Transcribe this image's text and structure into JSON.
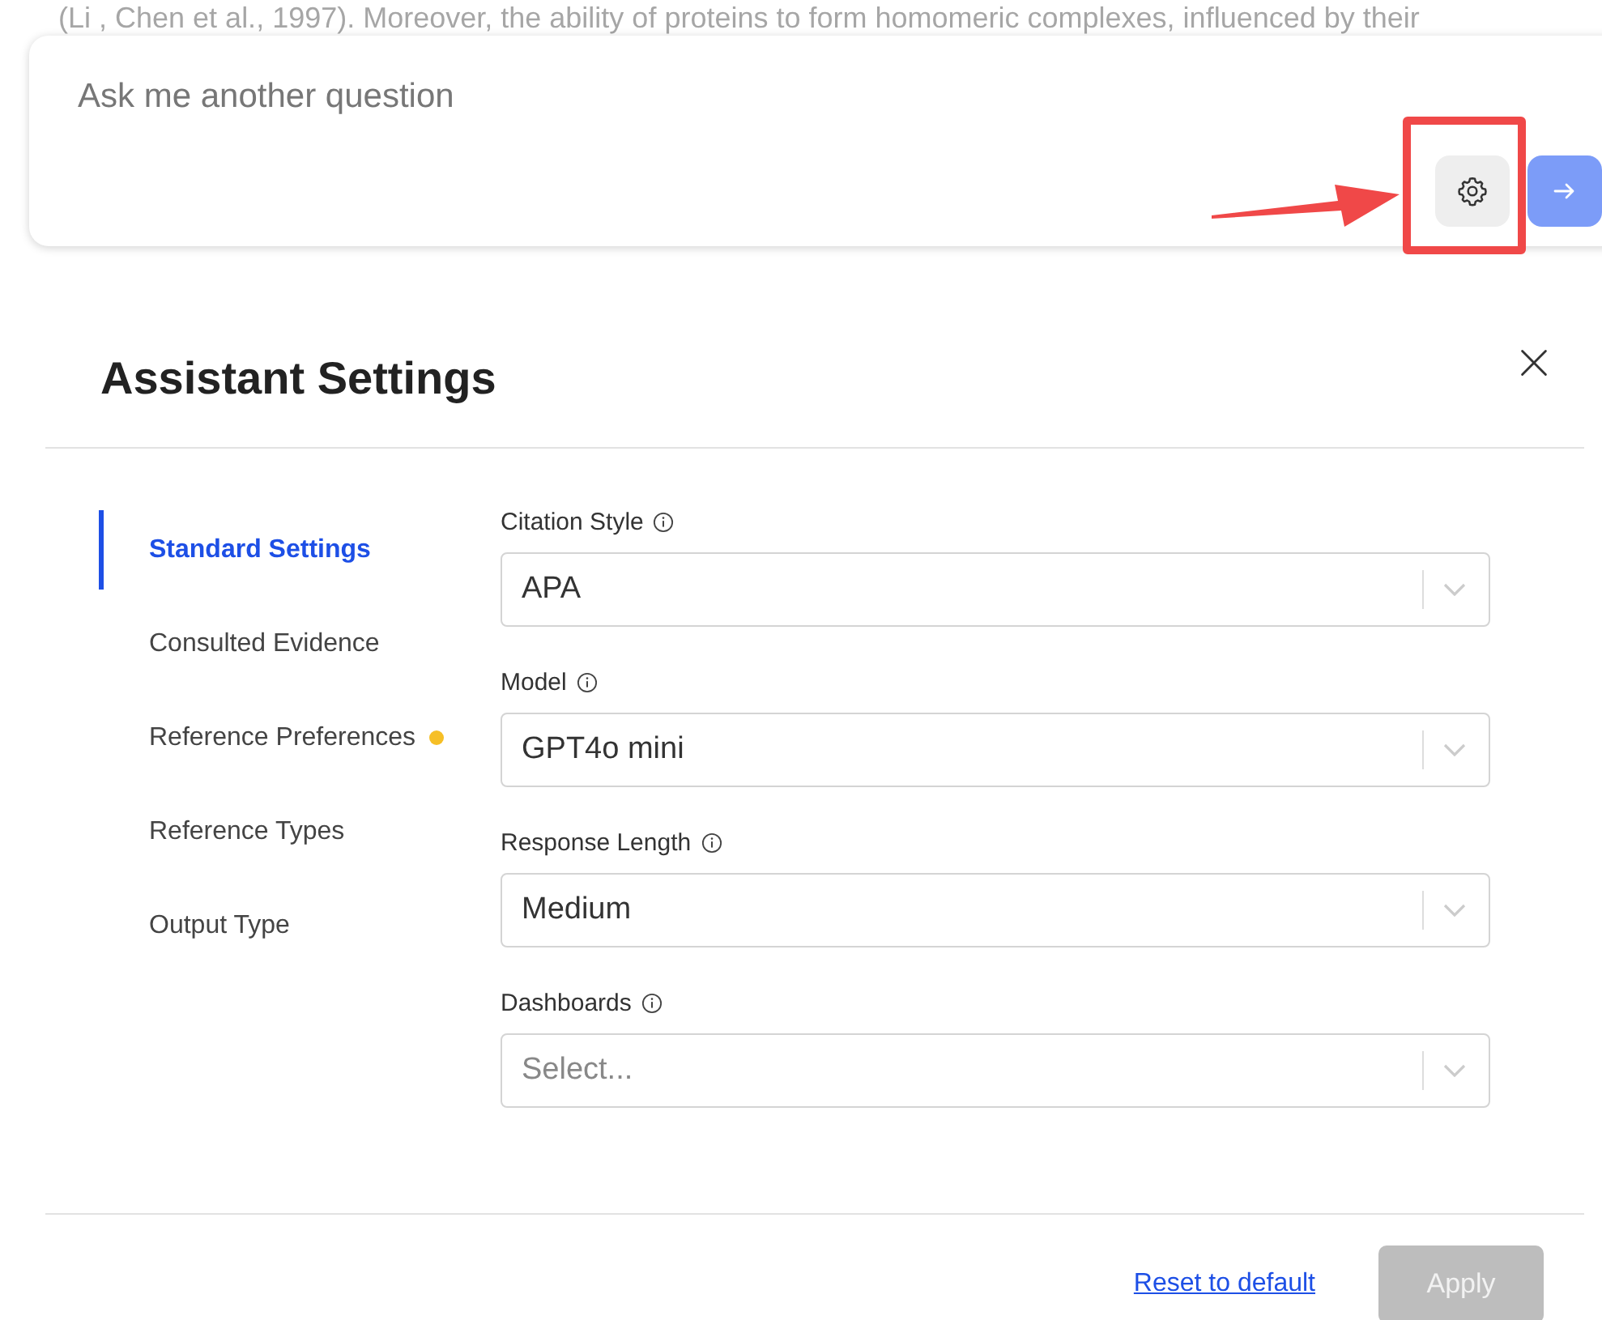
{
  "background_text": "(Li , Chen et al., 1997). Moreover, the ability of proteins to form homomeric complexes, influenced by their",
  "composer": {
    "placeholder": "Ask me another question",
    "settings_highlighted": true
  },
  "dialog": {
    "title": "Assistant Settings",
    "sidebar": {
      "items": [
        {
          "label": "Standard Settings",
          "selected": true,
          "modified": false
        },
        {
          "label": "Consulted Evidence",
          "selected": false,
          "modified": false
        },
        {
          "label": "Reference Preferences",
          "selected": false,
          "modified": true
        },
        {
          "label": "Reference Types",
          "selected": false,
          "modified": false
        },
        {
          "label": "Output Type",
          "selected": false,
          "modified": false
        }
      ]
    },
    "fields": [
      {
        "label": "Citation Style",
        "value": "APA"
      },
      {
        "label": "Model",
        "value": "GPT4o mini"
      },
      {
        "label": "Response Length",
        "value": "Medium"
      },
      {
        "label": "Dashboards",
        "placeholder": "Select..."
      }
    ],
    "footer": {
      "reset_link": "Reset to default",
      "apply_button": {
        "label": "Apply",
        "disabled": true
      }
    }
  }
}
